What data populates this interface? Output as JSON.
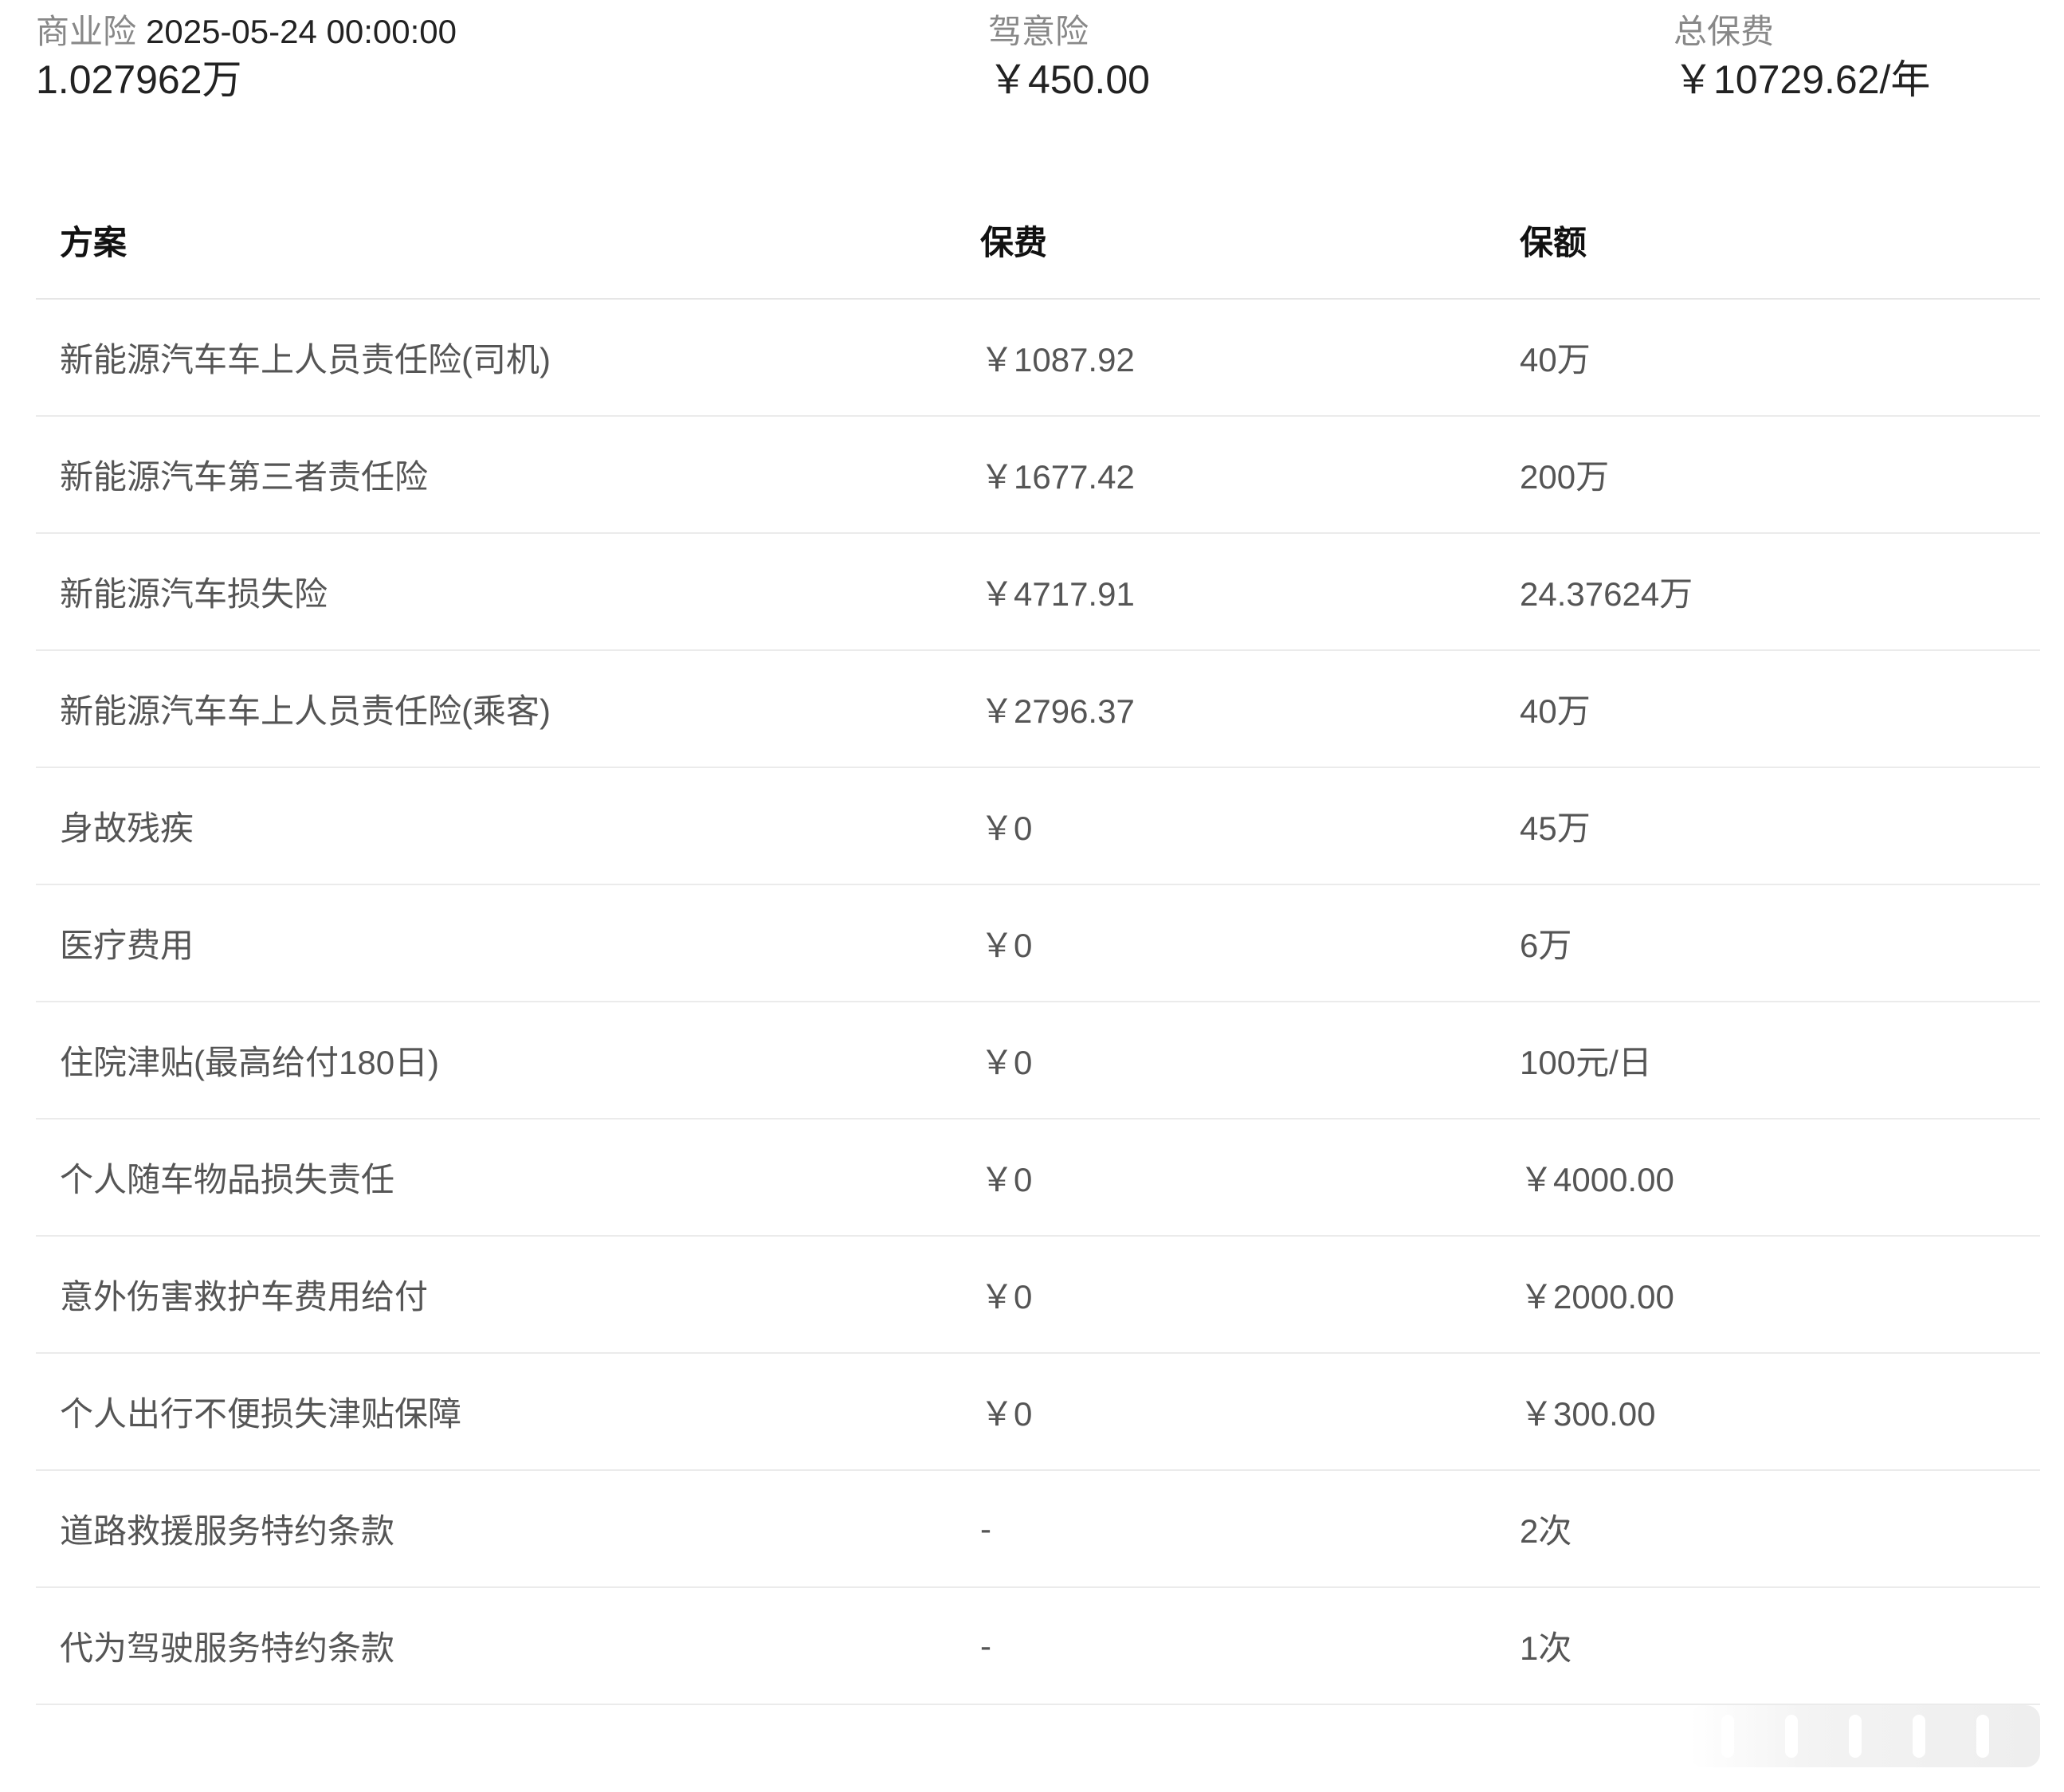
{
  "summary": {
    "commercial": {
      "label": "商业险",
      "date": "2025-05-24 00:00:00",
      "value": "1.027962万"
    },
    "driver_accident": {
      "label": "驾意险",
      "value": "￥450.00"
    },
    "total_premium": {
      "label": "总保费",
      "value": "￥10729.62/年"
    }
  },
  "table": {
    "headers": {
      "plan": "方案",
      "premium": "保费",
      "coverage": "保额"
    },
    "rows": [
      {
        "plan": "新能源汽车车上人员责任险(司机)",
        "premium": "￥1087.92",
        "coverage": "40万"
      },
      {
        "plan": "新能源汽车第三者责任险",
        "premium": "￥1677.42",
        "coverage": "200万"
      },
      {
        "plan": "新能源汽车损失险",
        "premium": "￥4717.91",
        "coverage": "24.37624万"
      },
      {
        "plan": "新能源汽车车上人员责任险(乘客)",
        "premium": "￥2796.37",
        "coverage": "40万"
      },
      {
        "plan": "身故残疾",
        "premium": "￥0",
        "coverage": "45万"
      },
      {
        "plan": "医疗费用",
        "premium": "￥0",
        "coverage": "6万"
      },
      {
        "plan": "住院津贴(最高给付180日)",
        "premium": "￥0",
        "coverage": "100元/日"
      },
      {
        "plan": "个人随车物品损失责任",
        "premium": "￥0",
        "coverage": "￥4000.00"
      },
      {
        "plan": "意外伤害救护车费用给付",
        "premium": "￥0",
        "coverage": "￥2000.00"
      },
      {
        "plan": "个人出行不便损失津贴保障",
        "premium": "￥0",
        "coverage": "￥300.00"
      },
      {
        "plan": "道路救援服务特约条款",
        "premium": "-",
        "coverage": "2次"
      },
      {
        "plan": "代为驾驶服务特约条款",
        "premium": "-",
        "coverage": "1次"
      }
    ]
  }
}
